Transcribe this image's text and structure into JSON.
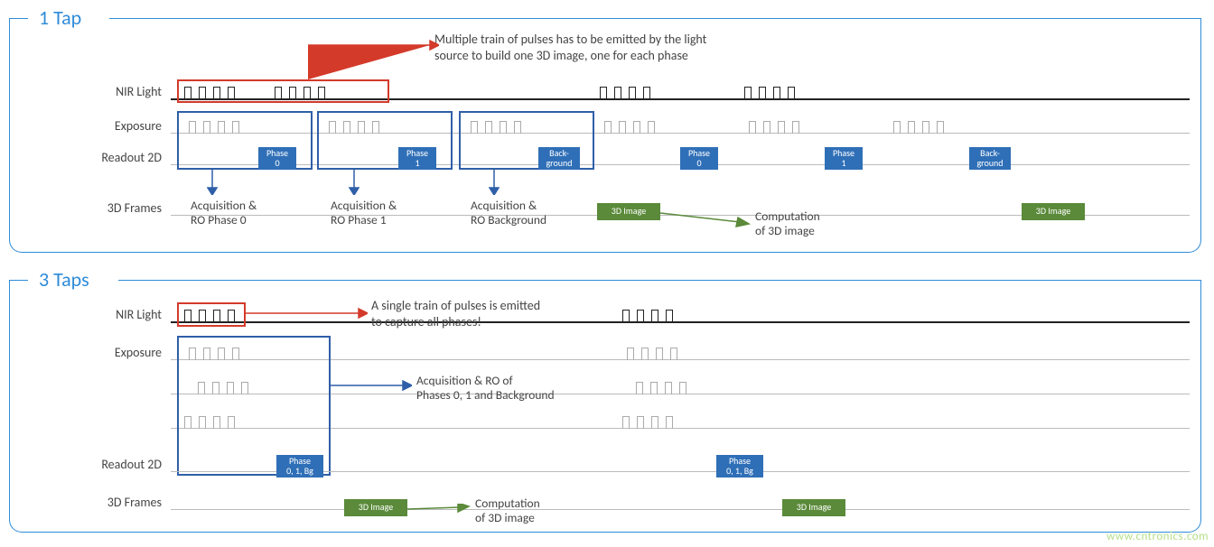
{
  "colors": {
    "accent_blue": "#2f8bd8",
    "block_blue": "#2f6fb7",
    "block_green": "#5a8a3a",
    "callout_red": "#d43a2a",
    "pulse_dark": "#222222",
    "pulse_light": "#aaaaaa"
  },
  "watermark": "www.cntronics.com",
  "one_tap": {
    "title": "1 Tap",
    "rows": {
      "nir": "NIR Light",
      "exposure": "Exposure",
      "readout": "Readout 2D",
      "frames": "3D Frames"
    },
    "callout": {
      "line1": "Multiple train of pulses has to be emitted by the light",
      "line2": "source to build one 3D image, one for each phase"
    },
    "phase_blocks": [
      "Phase\n0",
      "Phase\n1",
      "Back-\nground",
      "Phase\n0",
      "Phase\n1",
      "Back-\nground"
    ],
    "green_blocks": [
      "3D Image",
      "3D Image"
    ],
    "acq_labels": {
      "a0": {
        "l1": "Acquisition &",
        "l2": "RO Phase 0"
      },
      "a1": {
        "l1": "Acquisition &",
        "l2": "RO Phase 1"
      },
      "bg": {
        "l1": "Acquisition &",
        "l2": "RO Background"
      }
    },
    "compute_label": {
      "l1": "Computation",
      "l2": "of 3D image"
    }
  },
  "three_taps": {
    "title": "3 Taps",
    "rows": {
      "nir": "NIR Light",
      "exposure": "Exposure",
      "readout": "Readout 2D",
      "frames": "3D Frames"
    },
    "callout": {
      "line1": "A single train of pulses is emitted",
      "line2": "to capture all phases!"
    },
    "acq_label": {
      "l1": "Acquisition & RO of",
      "l2": "Phases 0, 1 and Background"
    },
    "phase_blocks": [
      "Phase\n0, 1, Bg",
      "Phase\n0, 1, Bg"
    ],
    "green_blocks": [
      "3D Image",
      "3D Image"
    ],
    "compute_label": {
      "l1": "Computation",
      "l2": "of 3D image"
    }
  }
}
